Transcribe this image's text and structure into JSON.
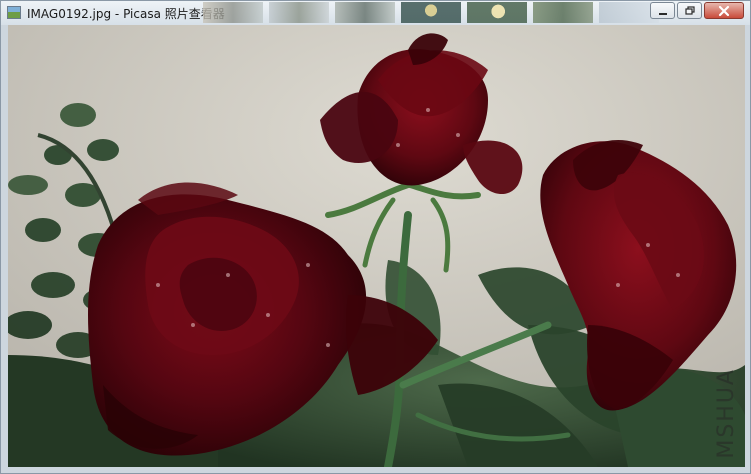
{
  "window": {
    "title": "IMAG0192.jpg - Picasa 照片查看器",
    "controls": {
      "minimize_icon": "minimize-icon",
      "restore_icon": "restore-icon",
      "close_icon": "close-icon"
    }
  },
  "thumbnails": [
    {
      "name": "thumb-1"
    },
    {
      "name": "thumb-2"
    },
    {
      "name": "thumb-3"
    },
    {
      "name": "thumb-4"
    },
    {
      "name": "thumb-5"
    },
    {
      "name": "thumb-6"
    },
    {
      "name": "thumb-7"
    }
  ],
  "photo": {
    "watermark": "MSHUA"
  },
  "colors": {
    "rose": "#6b0a12",
    "rose_dark": "#3c0208",
    "leaf": "#2f4f2f",
    "wall": "#d8d4cb"
  }
}
